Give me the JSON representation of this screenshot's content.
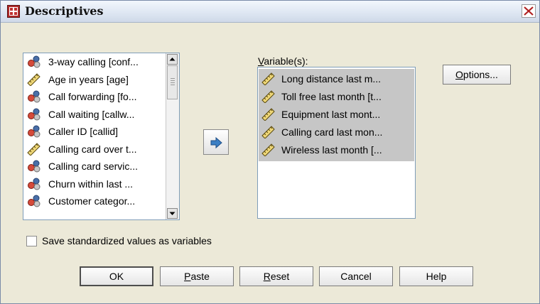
{
  "window": {
    "title": "Descriptives",
    "icon": "descriptives-app-icon"
  },
  "source_list": {
    "items": [
      {
        "label": "3-way calling [conf...",
        "icon": "nominal-measure-icon"
      },
      {
        "label": "Age in years [age]",
        "icon": "scale-ruler-icon"
      },
      {
        "label": "Call forwarding [fo...",
        "icon": "nominal-measure-icon"
      },
      {
        "label": "Call waiting [callw...",
        "icon": "nominal-measure-icon"
      },
      {
        "label": "Caller ID [callid]",
        "icon": "nominal-measure-icon"
      },
      {
        "label": "Calling card over t...",
        "icon": "scale-ruler-icon"
      },
      {
        "label": "Calling card servic...",
        "icon": "nominal-measure-icon"
      },
      {
        "label": "Churn within last ...",
        "icon": "nominal-measure-icon"
      },
      {
        "label": "Customer categor...",
        "icon": "nominal-measure-icon"
      }
    ]
  },
  "move_button": {
    "icon": "arrow-right-icon"
  },
  "variables": {
    "label": "Variable(s):",
    "mnemonic": "V",
    "items": [
      {
        "label": "Long distance last m...",
        "icon": "scale-ruler-icon"
      },
      {
        "label": "Toll free last month [t...",
        "icon": "scale-ruler-icon"
      },
      {
        "label": "Equipment last mont...",
        "icon": "scale-ruler-icon"
      },
      {
        "label": "Calling card last mon...",
        "icon": "scale-ruler-icon"
      },
      {
        "label": "Wireless last month [...",
        "icon": "scale-ruler-icon"
      }
    ]
  },
  "options_button": {
    "mnemonic": "O",
    "rest": "ptions..."
  },
  "save_standardized": {
    "label": "Save standardized values as variables",
    "checked": false
  },
  "buttons": {
    "ok": "OK",
    "paste": {
      "mnemonic": "P",
      "rest": "aste"
    },
    "reset": {
      "mnemonic": "R",
      "rest": "eset"
    },
    "cancel": "Cancel",
    "help": "Help"
  },
  "colors": {
    "dialog_bg": "#ece9d8",
    "selection_bg": "#c6c6c6",
    "list_border": "#7f9db9"
  }
}
